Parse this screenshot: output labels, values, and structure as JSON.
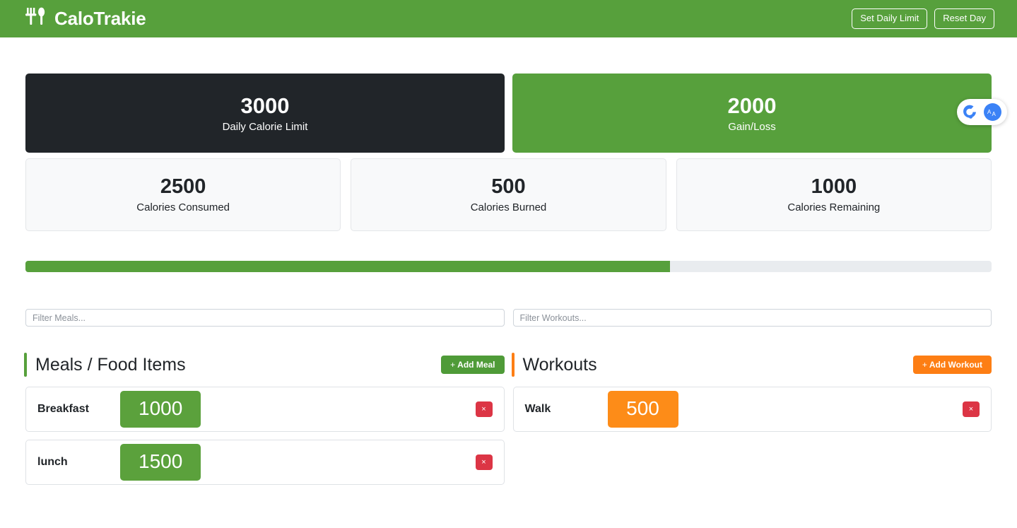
{
  "header": {
    "brand": "CaloTrakie",
    "brand_icon": "fork-and-spoon-icon",
    "buttons": [
      {
        "label": "Set Daily Limit",
        "name": "set-daily-limit-button"
      },
      {
        "label": "Reset Day",
        "name": "reset-day-button"
      }
    ],
    "background_color": "#57a03c"
  },
  "summary": {
    "limit_card": {
      "value": "3000",
      "label": "Daily Calorie Limit",
      "background_color": "#212529"
    },
    "gain_loss_card": {
      "value": "2000",
      "label": "Gain/Loss",
      "background_color": "#57a03c"
    },
    "stats": [
      {
        "value": "2500",
        "label": "Calories Consumed"
      },
      {
        "value": "500",
        "label": "Calories Burned"
      },
      {
        "value": "1000",
        "label": "Calories Remaining"
      }
    ]
  },
  "progress": {
    "percent": 66.7,
    "fill_color": "#57a03c",
    "track_color": "#e9ecef"
  },
  "filters": {
    "meals_placeholder": "Filter Meals...",
    "meals_value": "",
    "workouts_placeholder": "Filter Workouts...",
    "workouts_value": ""
  },
  "meals_panel": {
    "title": "Meals / Food Items",
    "accent_color": "#57a03c",
    "add_label": "Add Meal",
    "add_plus": "+",
    "delete_glyph": "×",
    "items": [
      {
        "name": "Breakfast",
        "calories": "1000"
      },
      {
        "name": "lunch",
        "calories": "1500"
      }
    ]
  },
  "workouts_panel": {
    "title": "Workouts",
    "accent_color": "#fd7e14",
    "add_label": "Add Workout",
    "add_plus": "+",
    "delete_glyph": "×",
    "items": [
      {
        "name": "Walk",
        "calories": "500"
      }
    ]
  },
  "float_widget": {
    "accessibility_icon": "accessibility-icon",
    "translate_icon": "translate-icon",
    "translate_glyph": "文A"
  }
}
